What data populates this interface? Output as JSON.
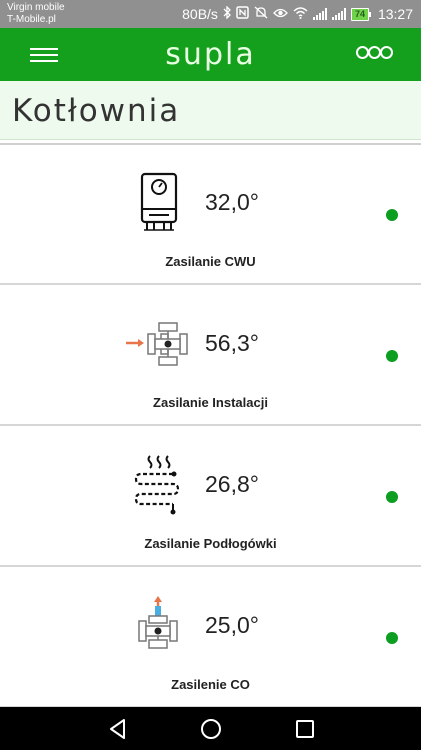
{
  "status_bar": {
    "carrier_line1": "Virgin mobile",
    "carrier_line2": "T-Mobile.pl",
    "net_speed": "80B/s",
    "icons": [
      "bluetooth-icon",
      "nfc-icon",
      "mute-icon",
      "eye-icon",
      "wifi-icon",
      "signal-icon",
      "signal-icon"
    ],
    "battery": "74",
    "time": "13:27"
  },
  "app_bar": {
    "logo": "supla",
    "menu_icon": "hamburger-menu-icon",
    "more_icon": "supla-dots-icon",
    "color": "#14a01c"
  },
  "location": {
    "title": "Kotłownia"
  },
  "channels": [
    {
      "caption": "Zasilanie CWU",
      "temperature": "32,0°",
      "icon": "boiler-icon",
      "status": "online"
    },
    {
      "caption": "Zasilanie Instalacji",
      "temperature": "56,3°",
      "icon": "mixing-valve-icon",
      "status": "online"
    },
    {
      "caption": "Zasilanie Podłogówki",
      "temperature": "26,8°",
      "icon": "floor-heating-icon",
      "status": "online"
    },
    {
      "caption": "Zasilenie CO",
      "temperature": "25,0°",
      "icon": "central-heating-valve-icon",
      "status": "online"
    }
  ],
  "nav_bar": {
    "buttons": [
      "back-icon",
      "home-icon",
      "recents-icon"
    ]
  },
  "colors": {
    "online": "#0c9e20",
    "header_bg": "#eefaee"
  }
}
